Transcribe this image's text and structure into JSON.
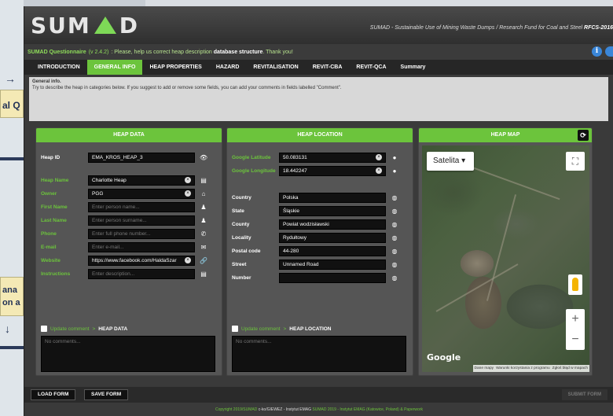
{
  "header": {
    "tagline": "SUMAD - Sustainable Use of Mining Waste Dumps / Research Fund for Coal and Steel",
    "tagline_code": "RFCS-2016"
  },
  "message": {
    "brand": "SUMAD Questionnaire",
    "version": "(v 2.4.2)",
    "text": ": Please, help us correct heap description",
    "bold": "database structure",
    "end": ". Thank you!"
  },
  "tabs": [
    {
      "label": "INTRODUCTION",
      "active": false
    },
    {
      "label": "GENERAL INFO",
      "active": true
    },
    {
      "label": "HEAP PROPERTIES",
      "active": false
    },
    {
      "label": "HAZARD",
      "active": false
    },
    {
      "label": "REVITALISATION",
      "active": false
    },
    {
      "label": "REVIT-CBA",
      "active": false
    },
    {
      "label": "REVIT-QCA",
      "active": false
    },
    {
      "label": "Summary",
      "active": false
    }
  ],
  "general_info": {
    "title": "General info.",
    "description": "Try to describe the heap in categories below. If you suggest to add or remove some fields, you can add your comments in fields labelled \"Comment\"."
  },
  "heap_data": {
    "title": "HEAP DATA",
    "heap_id_label": "Heap ID",
    "heap_id_value": "EMA_KROS_HEAP_3",
    "fields": [
      {
        "label": "Heap Name",
        "value": "Charlotte Heap",
        "placeholder": ""
      },
      {
        "label": "Owner",
        "value": "PGG",
        "placeholder": ""
      },
      {
        "label": "First Name",
        "value": "",
        "placeholder": "Enter person name..."
      },
      {
        "label": "Last Name",
        "value": "",
        "placeholder": "Enter person surname..."
      },
      {
        "label": "Phone",
        "value": "",
        "placeholder": "Enter full phone number..."
      },
      {
        "label": "E-mail",
        "value": "",
        "placeholder": "Enter e-mail..."
      },
      {
        "label": "Website",
        "value": "https://www.facebook.com/HaldaSzar",
        "placeholder": ""
      },
      {
        "label": "Instructions",
        "value": "",
        "placeholder": "Enter description..."
      }
    ],
    "comment_label": "Update comment",
    "comment_section": "HEAP DATA",
    "comment_placeholder": "No comments..."
  },
  "heap_location": {
    "title": "HEAP LOCATION",
    "coords": [
      {
        "label": "Google Latitude",
        "value": "50.083131"
      },
      {
        "label": "Google Longitude",
        "value": "18.442247"
      }
    ],
    "fields": [
      {
        "label": "Country",
        "value": "Polska"
      },
      {
        "label": "State",
        "value": "Śląskie"
      },
      {
        "label": "County",
        "value": "Powiat wodzisławski"
      },
      {
        "label": "Locality",
        "value": "Rydułtowy"
      },
      {
        "label": "Postal code",
        "value": "44-280"
      },
      {
        "label": "Street",
        "value": "Unnamed Road"
      },
      {
        "label": "Number",
        "value": ""
      }
    ],
    "comment_label": "Update comment",
    "comment_section": "HEAP LOCATION",
    "comment_placeholder": "No comments..."
  },
  "heap_map": {
    "title": "HEAP MAP",
    "map_type": "Satelita",
    "google": "Google",
    "footer": [
      "Dane mapy",
      "Warunki korzystania z programu",
      "Zgłoś błąd w mapach"
    ]
  },
  "footer": {
    "load": "LOAD FORM",
    "save": "SAVE FORM",
    "submit": "SUBMIT FORM"
  },
  "credits": {
    "left": "Copyright 2019/SUMAD",
    "middle": "c-ko/GIEWEZ - Instytut EMAG",
    "right": "SUMAD 2019 - Instytut EMAG (Katowice, Poland) & Paperwork"
  },
  "colors": {
    "accent": "#6cc43c",
    "bg": "#3a3a3a",
    "info": "#3a86d8"
  }
}
